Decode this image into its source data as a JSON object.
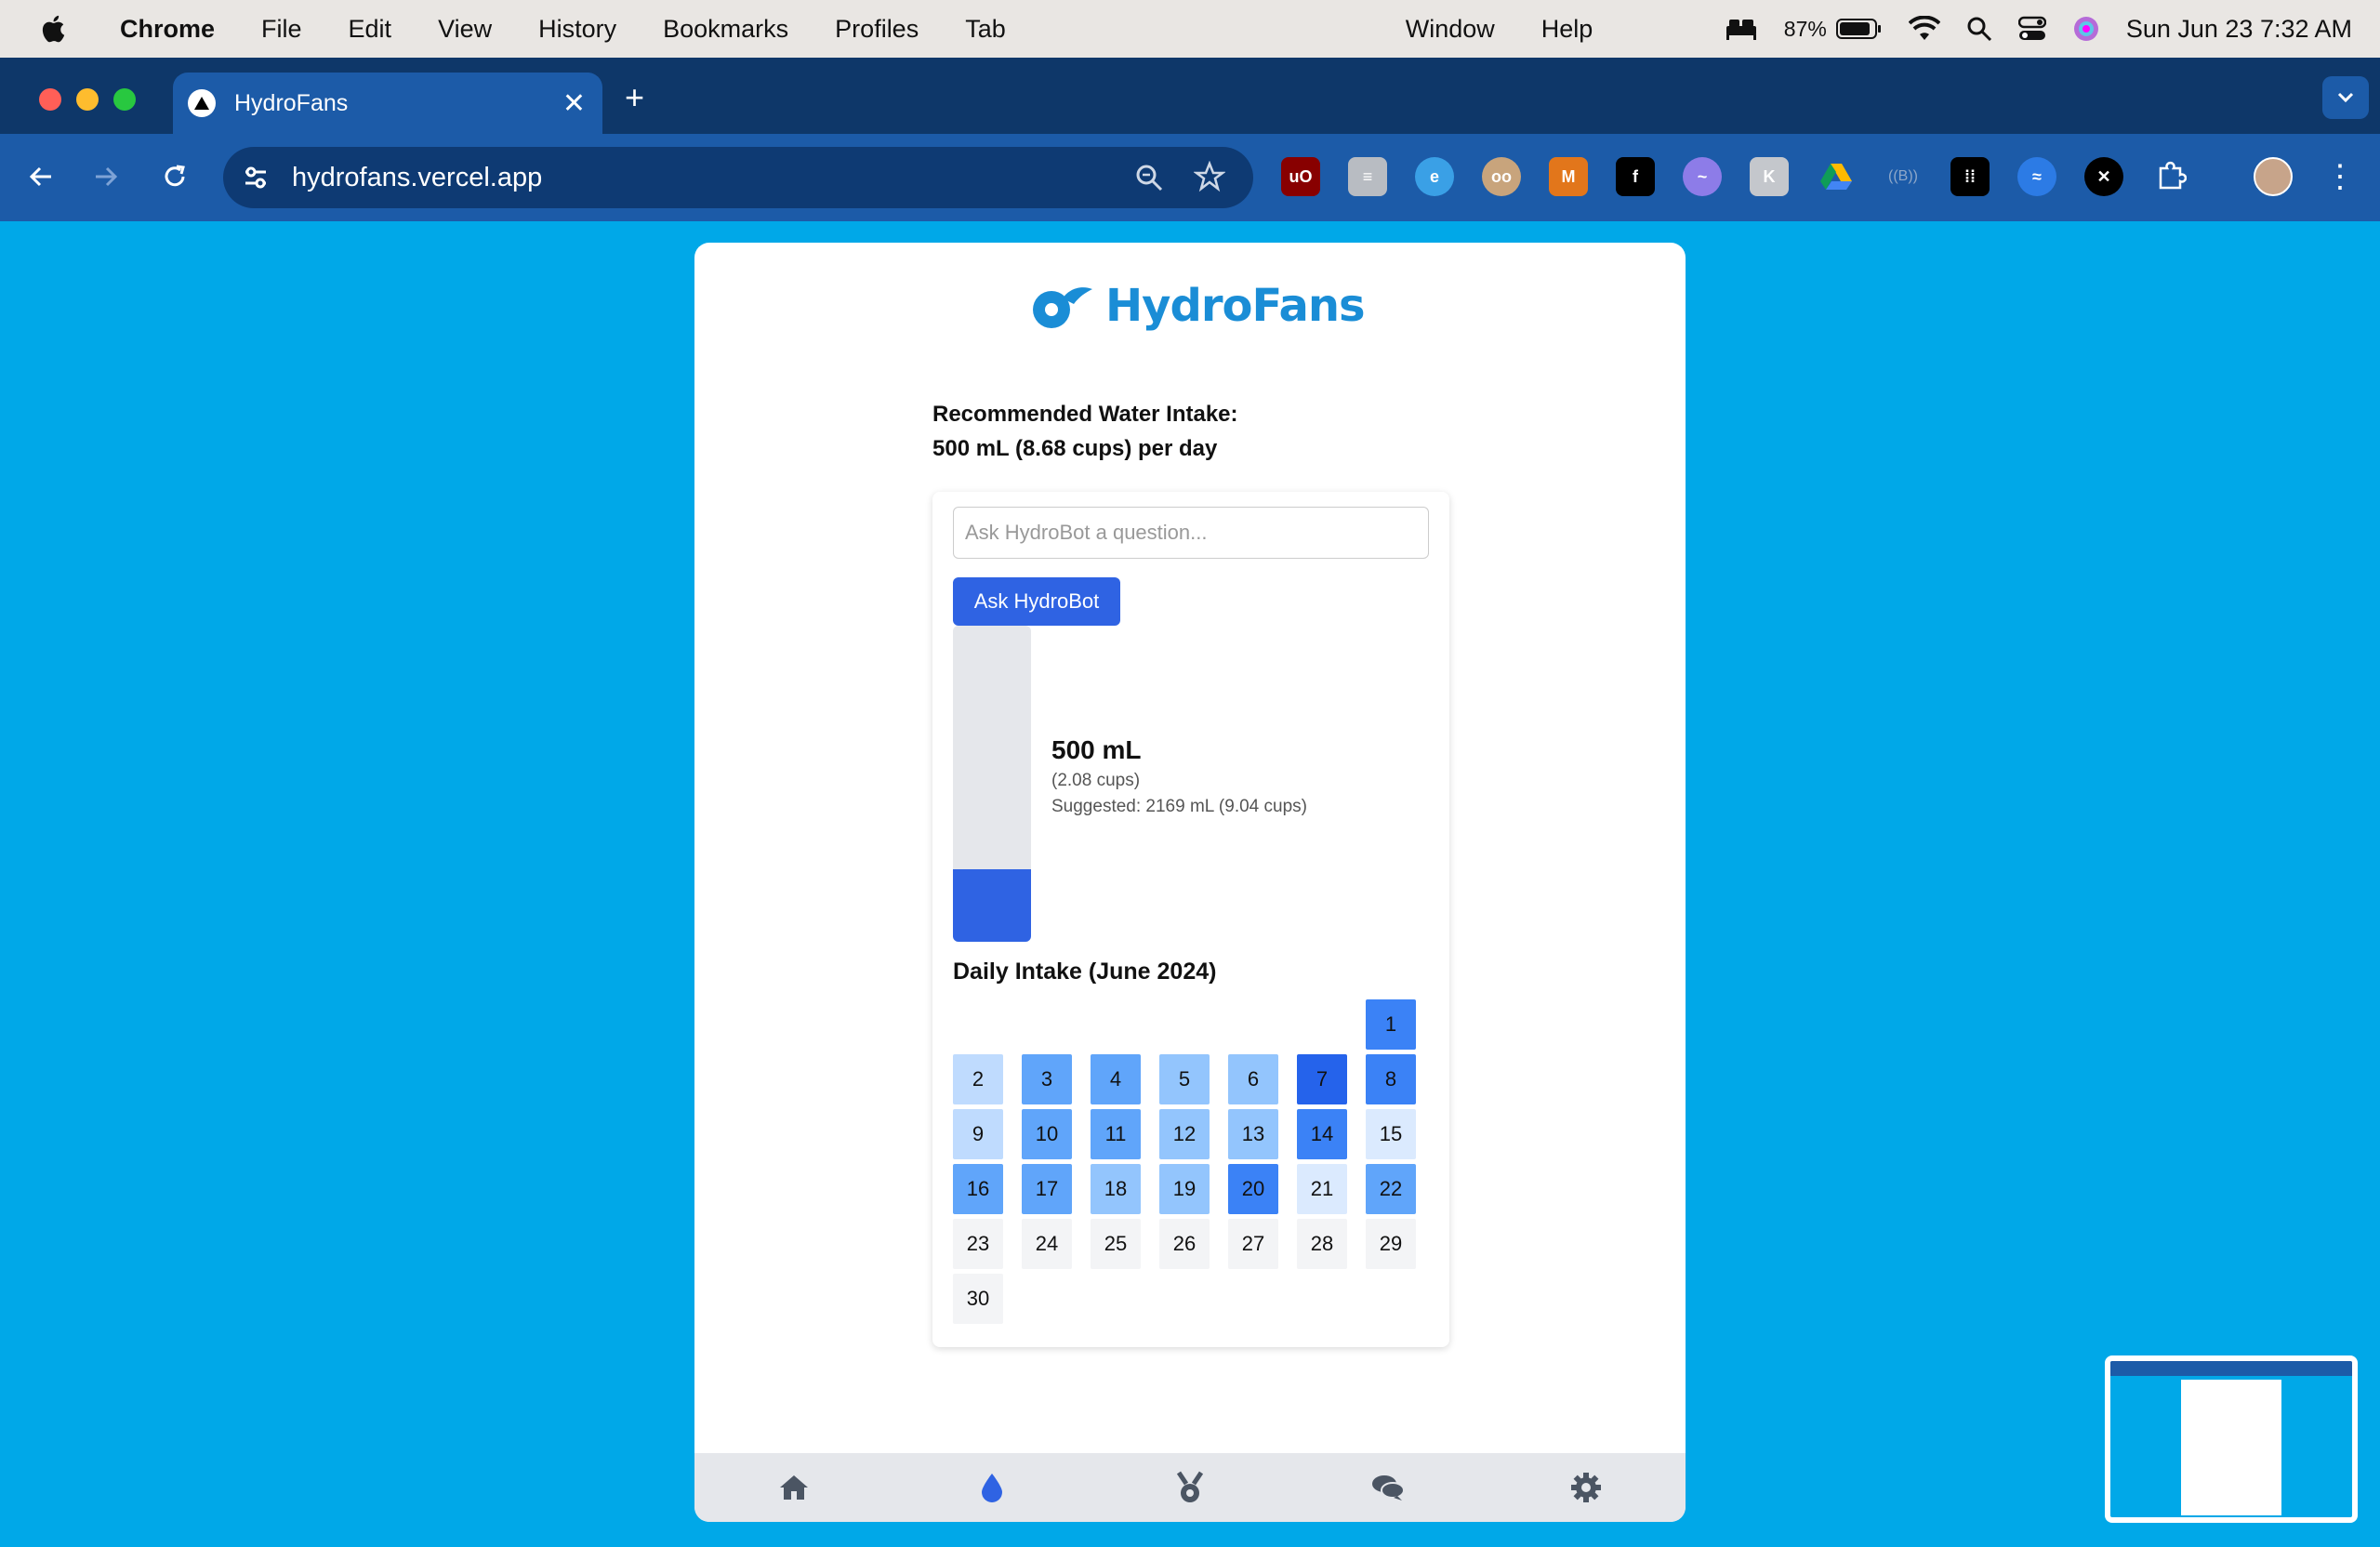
{
  "menubar": {
    "app_name": "Chrome",
    "menus": [
      "File",
      "Edit",
      "View",
      "History",
      "Bookmarks",
      "Profiles",
      "Tab"
    ],
    "menus_right": [
      "Window",
      "Help"
    ],
    "battery": "87%",
    "datetime": "Sun Jun 23  7:32 AM"
  },
  "browser": {
    "tab_title": "HydroFans",
    "url": "hydrofans.vercel.app"
  },
  "page": {
    "logo_text": "HydroFans",
    "recommended_line1": "Recommended Water Intake:",
    "recommended_line2": "500 mL (8.68 cups) per day",
    "ask_placeholder": "Ask HydroBot a question...",
    "ask_button": "Ask HydroBot",
    "intake_fraction": 0.23,
    "amount": "500 mL",
    "cups": "(2.08 cups)",
    "suggested": "Suggested: 2169 mL (9.04 cups)",
    "calendar_title": "Daily Intake (June 2024)",
    "calendar_start_weekday": 6,
    "days": [
      {
        "day": "1",
        "color": "#3b82f6"
      },
      {
        "day": "2",
        "color": "#bfdbfe"
      },
      {
        "day": "3",
        "color": "#60a5fa"
      },
      {
        "day": "4",
        "color": "#60a5fa"
      },
      {
        "day": "5",
        "color": "#93c5fd"
      },
      {
        "day": "6",
        "color": "#93c5fd"
      },
      {
        "day": "7",
        "color": "#2563eb"
      },
      {
        "day": "8",
        "color": "#3b82f6"
      },
      {
        "day": "9",
        "color": "#bfdbfe"
      },
      {
        "day": "10",
        "color": "#60a5fa"
      },
      {
        "day": "11",
        "color": "#60a5fa"
      },
      {
        "day": "12",
        "color": "#93c5fd"
      },
      {
        "day": "13",
        "color": "#93c5fd"
      },
      {
        "day": "14",
        "color": "#3b82f6"
      },
      {
        "day": "15",
        "color": "#dbeafe"
      },
      {
        "day": "16",
        "color": "#60a5fa"
      },
      {
        "day": "17",
        "color": "#60a5fa"
      },
      {
        "day": "18",
        "color": "#93c5fd"
      },
      {
        "day": "19",
        "color": "#93c5fd"
      },
      {
        "day": "20",
        "color": "#3b82f6"
      },
      {
        "day": "21",
        "color": "#dbeafe"
      },
      {
        "day": "22",
        "color": "#60a5fa"
      },
      {
        "day": "23",
        "color": "#f3f4f6"
      },
      {
        "day": "24",
        "color": "#f3f4f6"
      },
      {
        "day": "25",
        "color": "#f3f4f6"
      },
      {
        "day": "26",
        "color": "#f3f4f6"
      },
      {
        "day": "27",
        "color": "#f3f4f6"
      },
      {
        "day": "28",
        "color": "#f3f4f6"
      },
      {
        "day": "29",
        "color": "#f3f4f6"
      },
      {
        "day": "30",
        "color": "#f3f4f6"
      }
    ],
    "nav_items": [
      "home-icon",
      "water-drop-icon",
      "medal-icon",
      "chat-icon",
      "gear-icon"
    ],
    "accent_color": "#2f63e3"
  }
}
